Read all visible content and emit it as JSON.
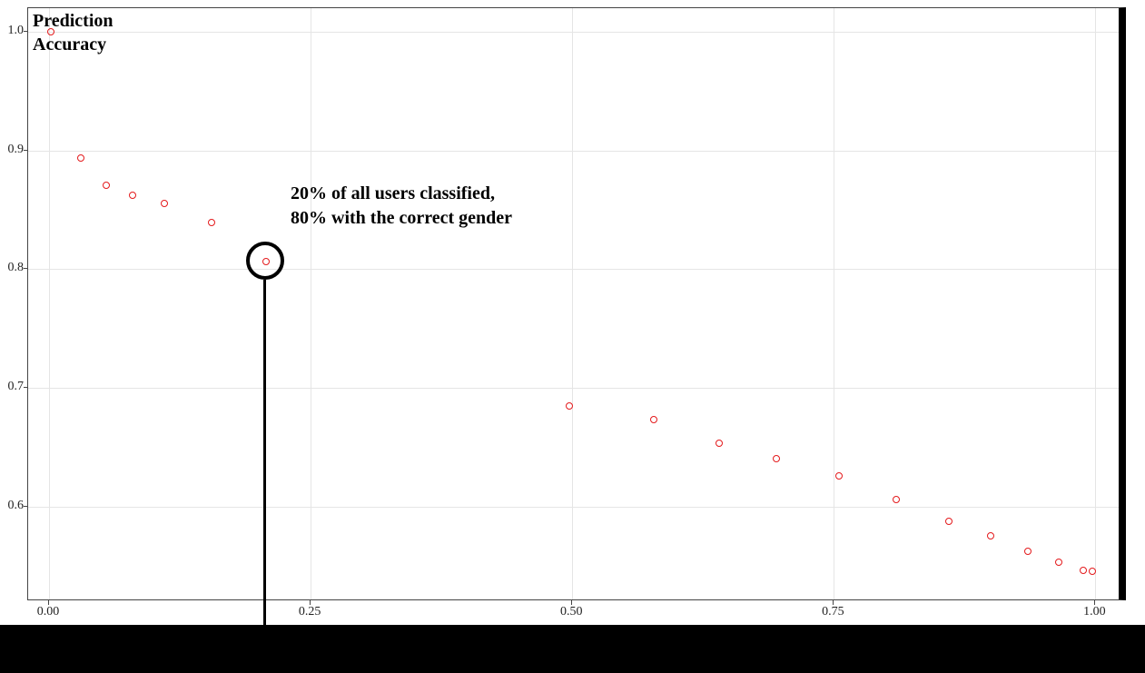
{
  "chart_data": {
    "type": "scatter",
    "title": "",
    "ylabel_line1": "Prediction",
    "ylabel_line2": "Accuracy",
    "xlabel": "",
    "xlim": [
      -0.02,
      1.03
    ],
    "ylim": [
      0.52,
      1.02
    ],
    "x_ticks": [
      "0.00",
      "0.25",
      "0.50",
      "0.75",
      "1.00"
    ],
    "y_ticks": [
      "0.6",
      "0.7",
      "0.8",
      "0.9",
      "1.0"
    ],
    "series": [
      {
        "name": "accuracy",
        "color": "#e41a1c",
        "points": [
          {
            "x": 0.002,
            "y": 1.0
          },
          {
            "x": 0.03,
            "y": 0.894
          },
          {
            "x": 0.055,
            "y": 0.871
          },
          {
            "x": 0.08,
            "y": 0.862
          },
          {
            "x": 0.11,
            "y": 0.855
          },
          {
            "x": 0.155,
            "y": 0.839
          },
          {
            "x": 0.207,
            "y": 0.806
          },
          {
            "x": 0.497,
            "y": 0.685
          },
          {
            "x": 0.578,
            "y": 0.673
          },
          {
            "x": 0.64,
            "y": 0.653
          },
          {
            "x": 0.695,
            "y": 0.64
          },
          {
            "x": 0.755,
            "y": 0.626
          },
          {
            "x": 0.81,
            "y": 0.606
          },
          {
            "x": 0.86,
            "y": 0.587
          },
          {
            "x": 0.9,
            "y": 0.575
          },
          {
            "x": 0.935,
            "y": 0.562
          },
          {
            "x": 0.965,
            "y": 0.553
          },
          {
            "x": 0.988,
            "y": 0.546
          },
          {
            "x": 0.997,
            "y": 0.545
          }
        ]
      }
    ],
    "annotation": {
      "line1": "20% of all users classified,",
      "line2": "80% with the correct gender",
      "target_x": 0.207,
      "target_y": 0.806
    }
  }
}
